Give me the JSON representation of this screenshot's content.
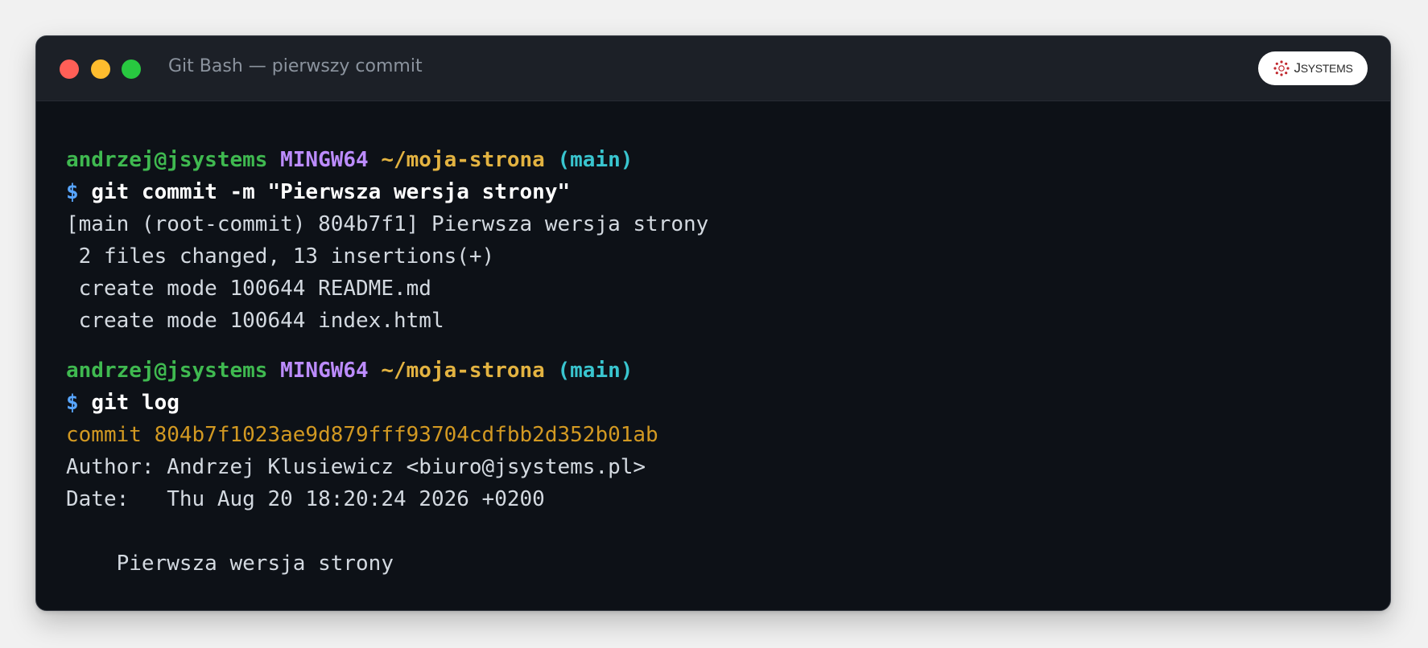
{
  "window": {
    "title": "Git Bash — pierwszy commit",
    "logo_text_first": "J",
    "logo_text_rest": "SYSTEMS"
  },
  "colors": {
    "user": "#3fb950",
    "mingw": "#bc8cff",
    "path": "#e3b341",
    "branch": "#39c5cf",
    "prompt": "#58a6ff",
    "commit_hash": "#d29922",
    "background": "#0d1117",
    "titlebar": "#1c2027"
  },
  "terminal": {
    "prompt1": {
      "user": "andrzej@jsystems",
      "system": "MINGW64",
      "path": "~/moja-strona",
      "branch": "(main)"
    },
    "command1": {
      "symbol": "$",
      "text": "git commit -m \"Pierwsza wersja strony\""
    },
    "output1": [
      "[main (root-commit) 804b7f1] Pierwsza wersja strony",
      " 2 files changed, 13 insertions(+)",
      " create mode 100644 README.md",
      " create mode 100644 index.html"
    ],
    "prompt2": {
      "user": "andrzej@jsystems",
      "system": "MINGW64",
      "path": "~/moja-strona",
      "branch": "(main)"
    },
    "command2": {
      "symbol": "$",
      "text": "git log"
    },
    "log": {
      "commit_line": "commit 804b7f1023ae9d879fff93704cdfbb2d352b01ab",
      "author_line": "Author: Andrzej Klusiewicz <biuro@jsystems.pl>",
      "date_line": "Date:   Thu Aug 20 18:20:24 2026 +0200",
      "message_line": "    Pierwsza wersja strony"
    }
  }
}
